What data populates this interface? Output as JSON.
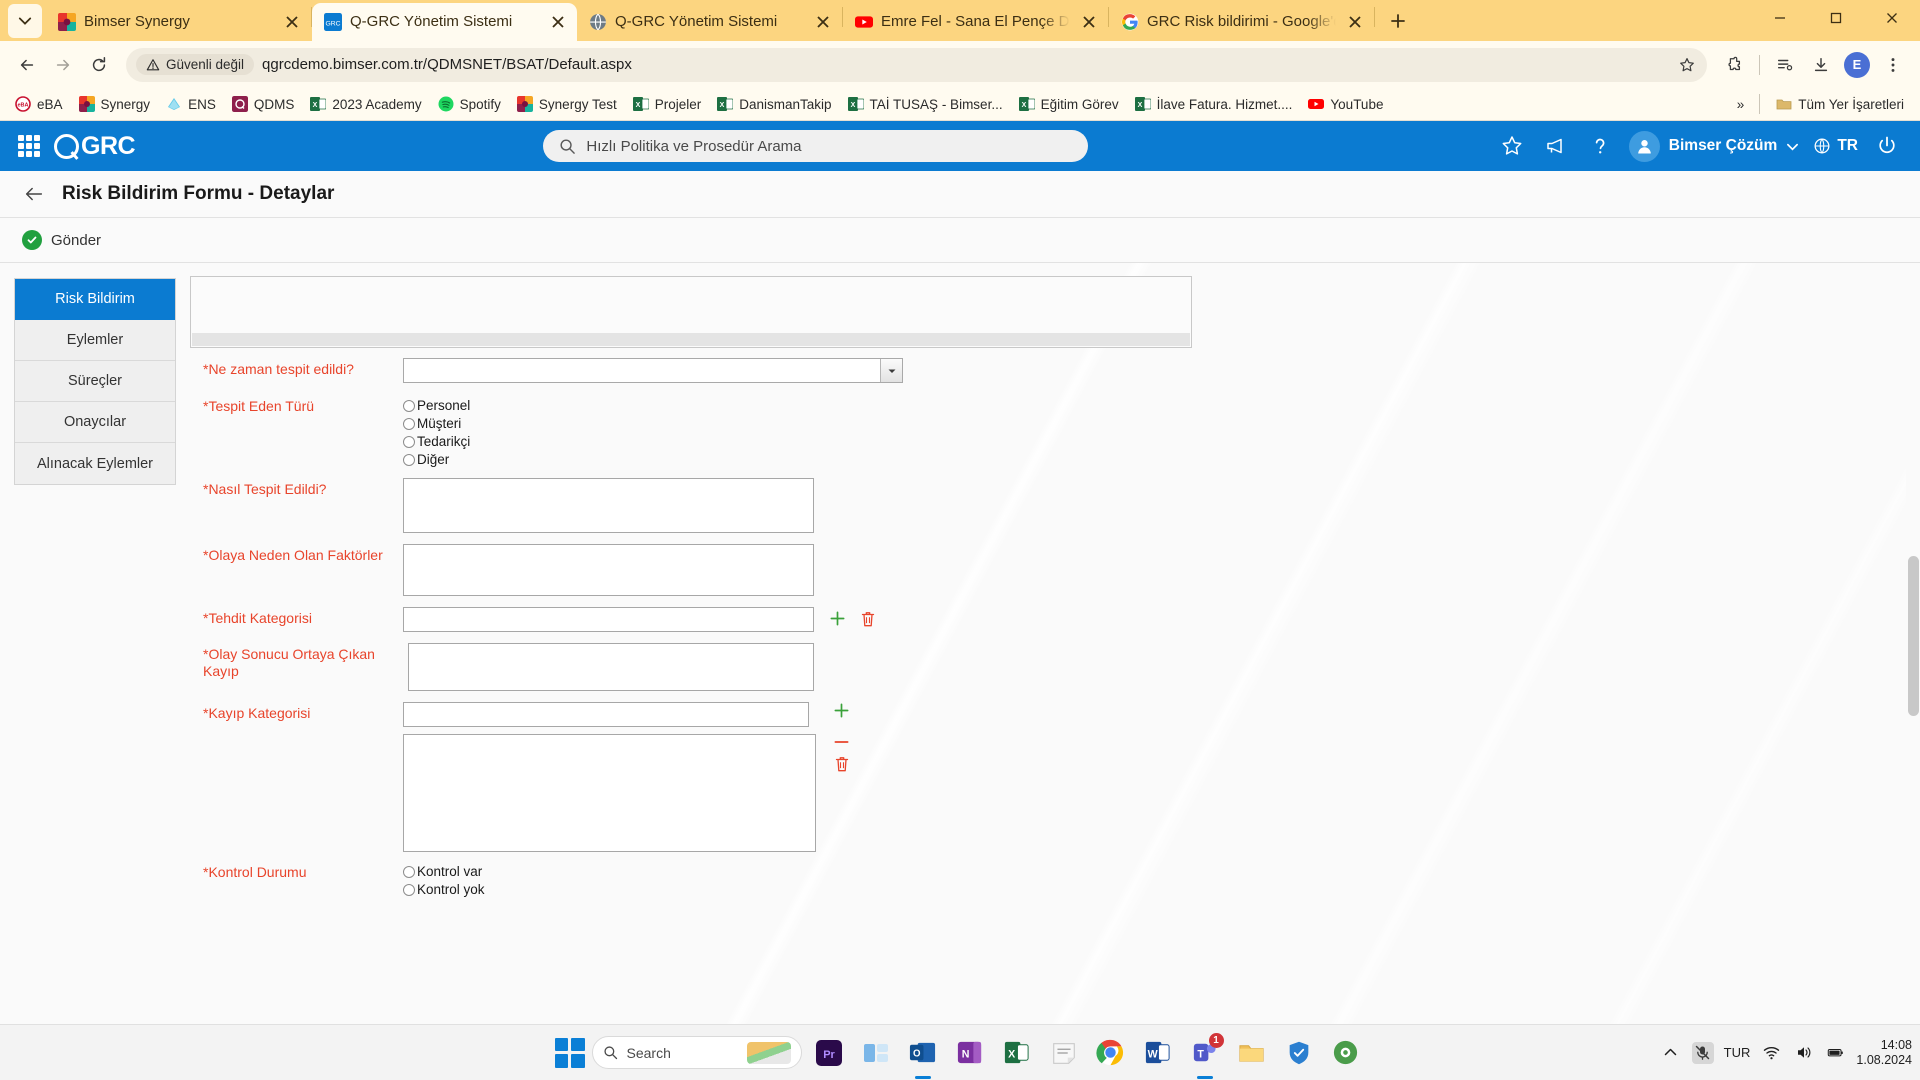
{
  "browser": {
    "tabs": [
      {
        "title": "Bimser Synergy",
        "favicon": "bimser-icon",
        "active": false
      },
      {
        "title": "Q-GRC Yönetim Sistemi",
        "favicon": "qgrc-icon",
        "active": true
      },
      {
        "title": "Q-GRC Yönetim Sistemi",
        "favicon": "globe-icon",
        "active": false
      },
      {
        "title": "Emre Fel - Sana El Pençe Durma",
        "favicon": "youtube-icon",
        "active": false
      },
      {
        "title": "GRC Risk bildirimi - Google'da A",
        "favicon": "google-icon",
        "active": false
      }
    ],
    "new_tab_label": "+",
    "toolbar": {
      "back": "Geri",
      "forward": "İleri",
      "reload": "Yeniden Yükle",
      "security_label": "Güvenli değil",
      "url": "qgrcdemo.bimser.com.tr/QDMSNET/BSAT/Default.aspx",
      "profile_initial": "E"
    },
    "bookmarks": [
      {
        "label": "eBA",
        "icon": "eba-icon"
      },
      {
        "label": "Synergy",
        "icon": "bimser-icon"
      },
      {
        "label": "ENS",
        "icon": "ens-icon"
      },
      {
        "label": "QDMS",
        "icon": "qdms-icon"
      },
      {
        "label": "2023 Academy",
        "icon": "excel-icon"
      },
      {
        "label": "Spotify",
        "icon": "spotify-icon"
      },
      {
        "label": "Synergy Test",
        "icon": "bimser-icon"
      },
      {
        "label": "Projeler",
        "icon": "excel-icon"
      },
      {
        "label": "DanismanTakip",
        "icon": "excel-icon"
      },
      {
        "label": "TAİ TUSAŞ - Bimser...",
        "icon": "excel-icon"
      },
      {
        "label": "Eğitim Görev",
        "icon": "excel-icon"
      },
      {
        "label": "İlave Fatura. Hizmet....",
        "icon": "excel-icon"
      },
      {
        "label": "YouTube",
        "icon": "youtube-icon"
      }
    ],
    "bookmarks_overflow": "»",
    "all_bookmarks_label": "Tüm Yer İşaretleri"
  },
  "app": {
    "brand": "GRC",
    "search_placeholder": "Hızlı Politika ve Prosedür Arama",
    "user_name": "Bimser Çözüm",
    "language": "TR",
    "header_icons": [
      "apps-grid-icon",
      "star-icon",
      "megaphone-icon",
      "help-icon",
      "power-icon"
    ],
    "accent_color": "#0b7bd1"
  },
  "page": {
    "title": "Risk Bildirim Formu - Detaylar",
    "submit_label": "Gönder",
    "side_tabs": [
      {
        "label": "Risk Bildirim",
        "active": true
      },
      {
        "label": "Eylemler",
        "active": false
      },
      {
        "label": "Süreçler",
        "active": false
      },
      {
        "label": "Onaycılar",
        "active": false
      },
      {
        "label": "Alınacak Eylemler",
        "active": false
      }
    ],
    "required_color": "#e8442b",
    "fields": [
      {
        "label": "*Ne zaman tespit edildi?",
        "type": "select",
        "value": "",
        "options": []
      },
      {
        "label": "*Tespit Eden Türü",
        "type": "radio",
        "options": [
          "Personel",
          "Müşteri",
          "Tedarikçi",
          "Diğer"
        ],
        "selected": ""
      },
      {
        "label": "*Nasıl Tespit Edildi?",
        "type": "textarea",
        "value": ""
      },
      {
        "label": "*Olaya Neden Olan Faktörler",
        "type": "textarea",
        "value": ""
      },
      {
        "label": "*Tehdit Kategorisi",
        "type": "text-with-actions",
        "value": "",
        "actions": [
          "plus-icon",
          "trash-icon"
        ]
      },
      {
        "label": "*Olay Sonucu Ortaya Çıkan Kayıp",
        "type": "textarea",
        "value": ""
      },
      {
        "label": "*Kayıp Kategorisi",
        "type": "text-with-stack-actions",
        "value": "",
        "actions": [
          "plus-icon",
          "minus-icon",
          "trash-icon"
        ]
      },
      {
        "label": "",
        "type": "textarea-large",
        "value": ""
      },
      {
        "label": "*Kontrol Durumu",
        "type": "radio",
        "options": [
          "Kontrol var",
          "Kontrol yok"
        ],
        "selected": ""
      }
    ]
  },
  "taskbar": {
    "search_placeholder": "Search",
    "apps": [
      {
        "name": "windows-start-icon",
        "badge": ""
      },
      {
        "name": "premiere-icon",
        "badge": ""
      },
      {
        "name": "task-view-icon",
        "badge": ""
      },
      {
        "name": "outlook-icon",
        "badge": ""
      },
      {
        "name": "onenote-icon",
        "badge": ""
      },
      {
        "name": "excel-icon",
        "badge": ""
      },
      {
        "name": "sticky-notes-icon",
        "badge": ""
      },
      {
        "name": "chrome-icon",
        "badge": ""
      },
      {
        "name": "word-icon",
        "badge": ""
      },
      {
        "name": "teams-icon",
        "badge": "1"
      },
      {
        "name": "file-explorer-icon",
        "badge": ""
      },
      {
        "name": "security-icon",
        "badge": ""
      },
      {
        "name": "settings-icon",
        "badge": ""
      }
    ],
    "language": "TUR",
    "time": "14:08",
    "date": "1.08.2024"
  }
}
